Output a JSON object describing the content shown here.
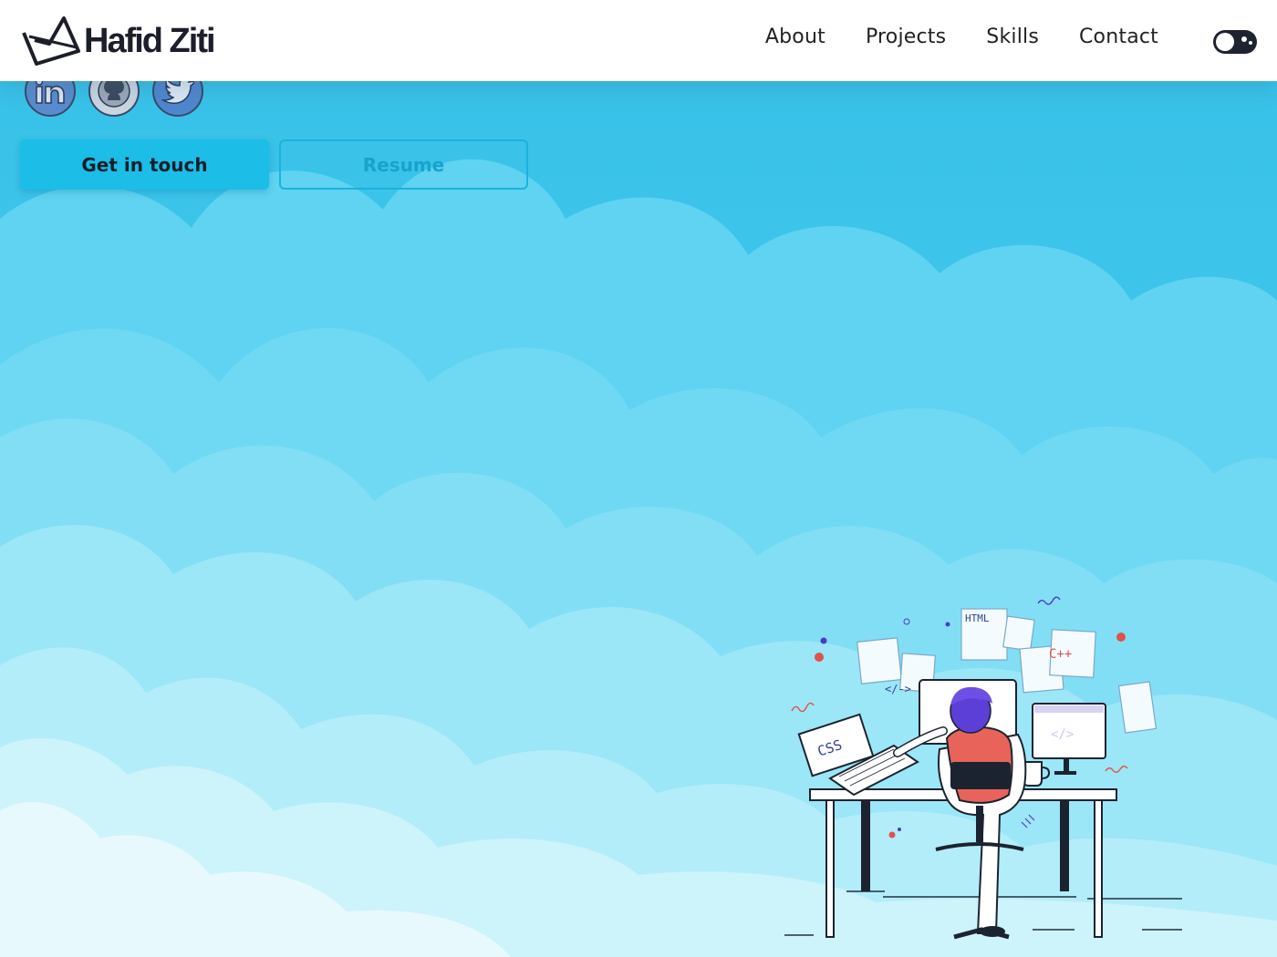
{
  "brand": {
    "name": "Hafid Ziti"
  },
  "nav": {
    "about": "About",
    "projects": "Projects",
    "skills": "Skills",
    "contact": "Contact"
  },
  "theme_toggle": {
    "icon": "moon-toggle"
  },
  "socials": [
    {
      "name": "linkedin",
      "icon": "linkedin-icon"
    },
    {
      "name": "github",
      "icon": "github-icon"
    },
    {
      "name": "twitter",
      "icon": "twitter-icon"
    }
  ],
  "hero": {
    "primary_button": "Get in touch",
    "secondary_button": "Resume"
  },
  "illustration": {
    "labels": {
      "css": "CSS",
      "html": "HTML",
      "cpp": "C++",
      "tag": "</->"
    }
  },
  "colors": {
    "accent": "#1cbde6",
    "sky_top": "#3cc6ea",
    "sky_bottom": "#e6f8fd",
    "hair": "#5b3fd6",
    "shirt": "#e8635a"
  }
}
